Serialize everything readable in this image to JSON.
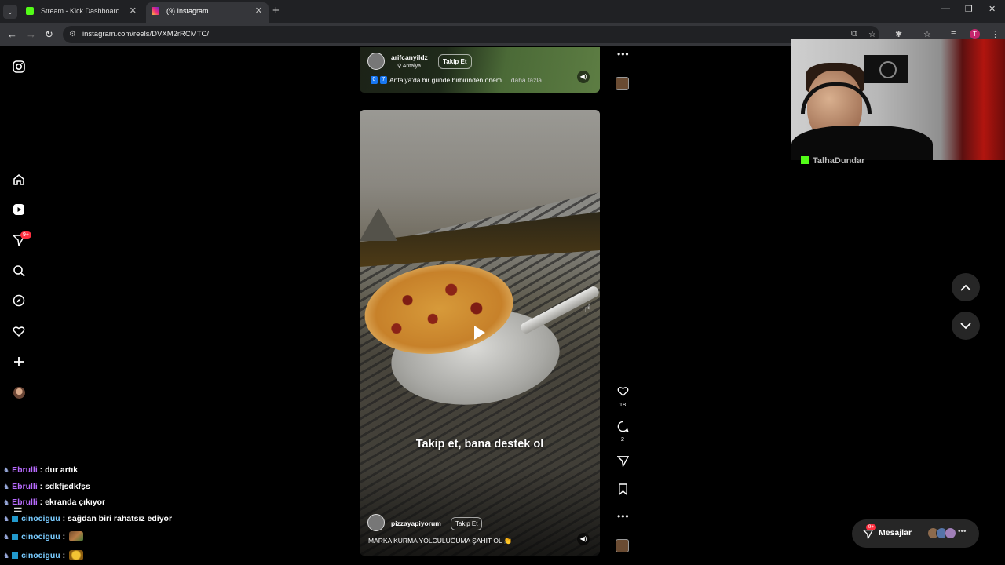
{
  "browser": {
    "tabs": [
      {
        "title": "Stream - Kick Dashboard"
      },
      {
        "title": "(9) Instagram"
      }
    ],
    "url": "instagram.com/reels/DVXM2rRCMTC/",
    "profile_initial": "T"
  },
  "sidebar": {
    "notifications_badge": "9+"
  },
  "reel_top": {
    "username": "arifcanyildz",
    "location": "Antalya",
    "follow_label": "Takip Et",
    "tags": [
      "0",
      "7"
    ],
    "caption": "Antalya'da bir günde birbirinden önem ...",
    "more_label": "daha fazla"
  },
  "reel_main": {
    "overlay_text": "Takip et, bana destek ol",
    "username": "pizzayapiyorum",
    "follow_label": "Takip Et",
    "description": "MARKA KURMA YOLCULUĞUMA ŞAHİT OL 👏"
  },
  "reel_actions": {
    "likes": "18",
    "comments": "2"
  },
  "webcam": {
    "streamer_name": "TalhaDundar"
  },
  "chat": [
    {
      "user": "Ebrulli",
      "text": ": dur artık",
      "color": "#b86bff"
    },
    {
      "user": "Ebrulli",
      "text": ": sdkfjsdkfşs",
      "color": "#b86bff"
    },
    {
      "user": "Ebrulli",
      "text": ": ekranda çıkıyor",
      "color": "#b86bff"
    },
    {
      "user": "cinociguu",
      "text": ": sağdan biri rahatsız ediyor",
      "color": "#79cbff"
    },
    {
      "user": "cinociguu",
      "text": ":",
      "color": "#79cbff"
    },
    {
      "user": "cinociguu",
      "text": ":",
      "color": "#79cbff"
    }
  ],
  "messages": {
    "label": "Mesajlar",
    "badge": "9+"
  },
  "colors": {
    "kick_green": "#53fc18",
    "ig_badge": "#ff3040",
    "chat_purple": "#b86bff",
    "chat_cyan": "#79cbff"
  }
}
